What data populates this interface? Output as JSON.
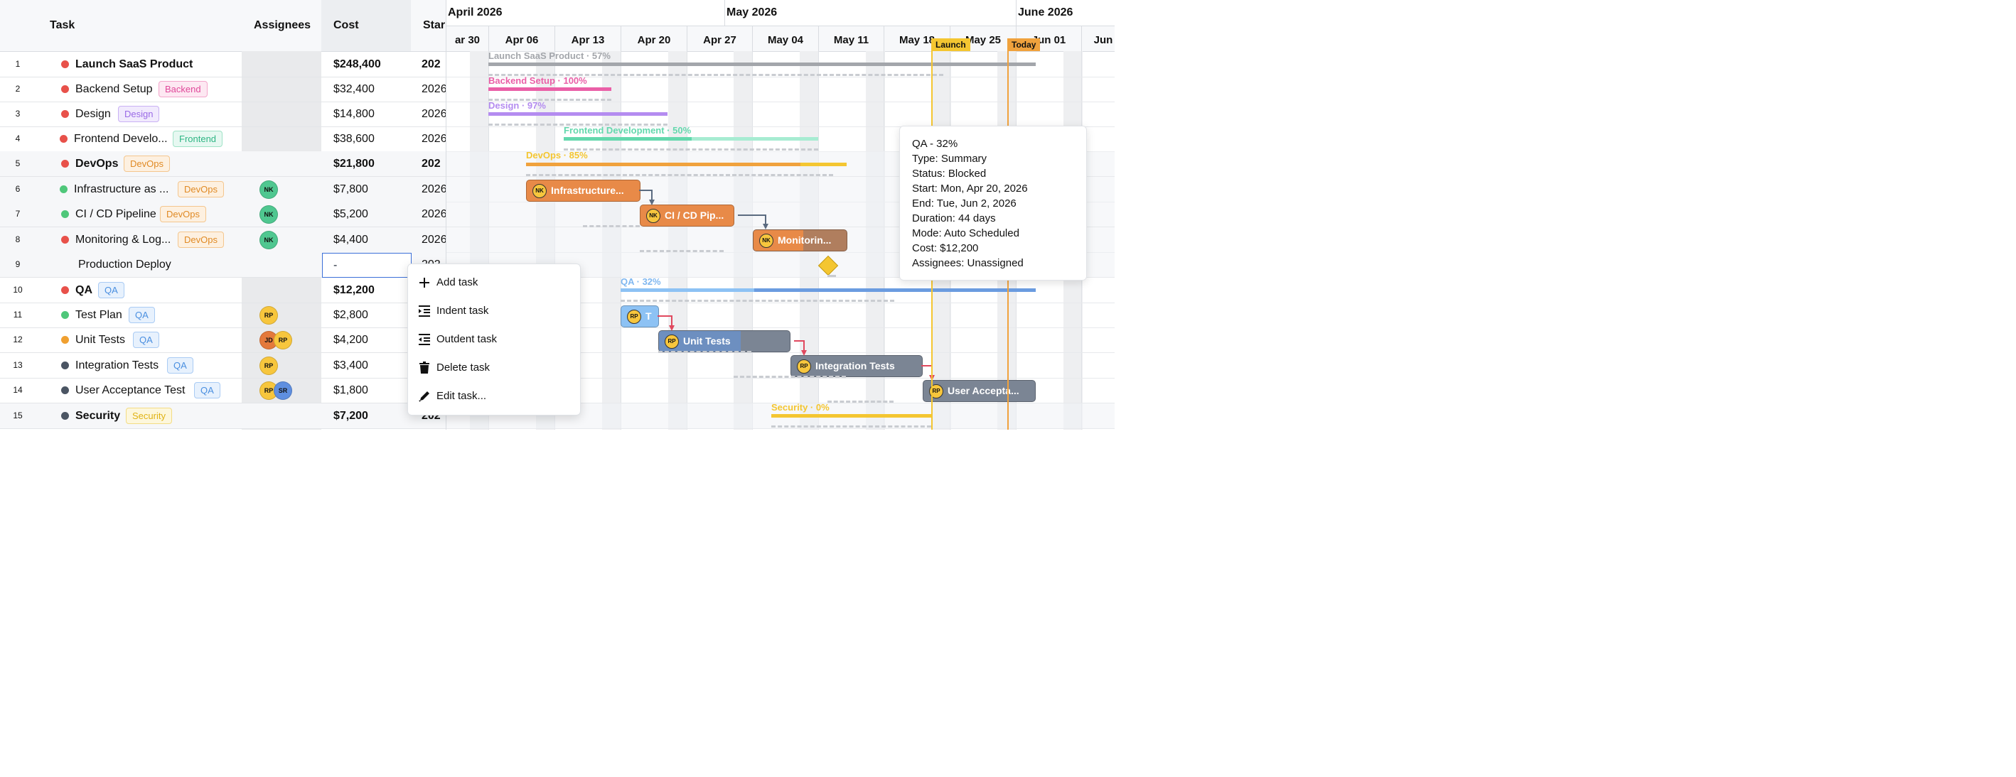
{
  "grid": {
    "headers": {
      "task": "Task",
      "assignees": "Assignees",
      "cost": "Cost",
      "start": "Star"
    },
    "rows": [
      {
        "num": "1",
        "name": "Launch SaaS Product",
        "bold": true,
        "dot": "#e8514a",
        "tag": "",
        "avatars": [],
        "cost": "$248,400",
        "start": "202"
      },
      {
        "num": "2",
        "name": "Backend Setup",
        "bold": false,
        "dot": "#e8514a",
        "tag": "Backend",
        "avatars": [],
        "cost": "$32,400",
        "start": "2026"
      },
      {
        "num": "3",
        "name": "Design",
        "bold": false,
        "dot": "#e8514a",
        "tag": "Design",
        "avatars": [],
        "cost": "$14,800",
        "start": "2026"
      },
      {
        "num": "4",
        "name": "Frontend Develo...",
        "bold": false,
        "dot": "#e8514a",
        "tag": "Frontend",
        "avatars": [],
        "cost": "$38,600",
        "start": "2026"
      },
      {
        "num": "5",
        "name": "DevOps",
        "bold": true,
        "dot": "#e8514a",
        "tag": "DevOps",
        "avatars": [],
        "cost": "$21,800",
        "start": "202"
      },
      {
        "num": "6",
        "name": "Infrastructure as ...",
        "bold": false,
        "dot": "#4fc77a",
        "tag": "DevOps",
        "avatars": [
          "NK"
        ],
        "cost": "$7,800",
        "start": "2026"
      },
      {
        "num": "7",
        "name": "CI / CD Pipeline",
        "bold": false,
        "dot": "#4fc77a",
        "tag": "DevOps",
        "avatars": [
          "NK"
        ],
        "cost": "$5,200",
        "start": "2026"
      },
      {
        "num": "8",
        "name": "Monitoring & Log...",
        "bold": false,
        "dot": "#e8514a",
        "tag": "DevOps",
        "avatars": [
          "NK"
        ],
        "cost": "$4,400",
        "start": "2026"
      },
      {
        "num": "9",
        "name": "Production Deploy",
        "bold": false,
        "dot": "",
        "tag": "",
        "avatars": [],
        "cost": "-",
        "start": "202"
      },
      {
        "num": "10",
        "name": "QA",
        "bold": true,
        "dot": "#e8514a",
        "tag": "QA",
        "avatars": [],
        "cost": "$12,200",
        "start": "202"
      },
      {
        "num": "11",
        "name": "Test Plan",
        "bold": false,
        "dot": "#4fc77a",
        "tag": "QA",
        "avatars": [
          "RP"
        ],
        "cost": "$2,800",
        "start": "2026"
      },
      {
        "num": "12",
        "name": "Unit Tests",
        "bold": false,
        "dot": "#f0a030",
        "tag": "QA",
        "avatars": [
          "JD",
          "RP"
        ],
        "cost": "$4,200",
        "start": "2026"
      },
      {
        "num": "13",
        "name": "Integration Tests",
        "bold": false,
        "dot": "#4b5563",
        "tag": "QA",
        "avatars": [
          "RP"
        ],
        "cost": "$3,400",
        "start": "2026"
      },
      {
        "num": "14",
        "name": "User Acceptance Test",
        "bold": false,
        "dot": "#4b5563",
        "tag": "QA",
        "avatars": [
          "RP",
          "SR"
        ],
        "cost": "$1,800",
        "start": "2026"
      },
      {
        "num": "15",
        "name": "Security",
        "bold": true,
        "dot": "#4b5563",
        "tag": "Security",
        "avatars": [],
        "cost": "$7,200",
        "start": "202"
      }
    ]
  },
  "timeline": {
    "months": [
      "April 2026",
      "May 2026",
      "June 2026"
    ],
    "weeks": [
      "ar 30",
      "Apr 06",
      "Apr 13",
      "Apr 20",
      "Apr 27",
      "May 04",
      "May 11",
      "May 18",
      "May 25",
      "Jun 01",
      "Jun"
    ],
    "markers": {
      "launch": "Launch",
      "today": "Today"
    },
    "bars": {
      "launch": "Launch SaaS Product · 57%",
      "backend": "Backend Setup · 100%",
      "design": "Design · 97%",
      "frontend": "Frontend Development · 50%",
      "devops": "DevOps · 85%",
      "infra": "Infrastructure...",
      "cicd": "CI / CD Pip...",
      "monitoring": "Monitorin...",
      "qa": "QA · 32%",
      "testplan": "T",
      "unittests": "Unit Tests",
      "integration": "Integration Tests",
      "uat": "User Accepta...",
      "security": "Security · 0%"
    }
  },
  "context_menu": {
    "items": [
      {
        "label": "Add task",
        "icon": "plus-icon"
      },
      {
        "label": "Indent task",
        "icon": "indent-icon"
      },
      {
        "label": "Outdent task",
        "icon": "outdent-icon"
      },
      {
        "label": "Delete task",
        "icon": "trash-icon"
      },
      {
        "label": "Edit task...",
        "icon": "pencil-icon"
      }
    ]
  },
  "tooltip": {
    "title": "QA - 32%",
    "type": "Type: Summary",
    "status": "Status: Blocked",
    "start": "Start: Mon, Apr 20, 2026",
    "end": "End: Tue, Jun 2, 2026",
    "duration": "Duration: 44 days",
    "mode": "Mode: Auto Scheduled",
    "cost": "Cost: $12,200",
    "assignees": "Assignees: Unassigned"
  },
  "colors": {
    "backend": "#ea5fa7",
    "design": "#b48cf0",
    "frontend": "#63d8ad",
    "devops": "#f0a23d",
    "qa": "#7fb7f0",
    "security": "#f4c631",
    "marker": "#f0a23d",
    "selection": "#3b6fd8"
  }
}
